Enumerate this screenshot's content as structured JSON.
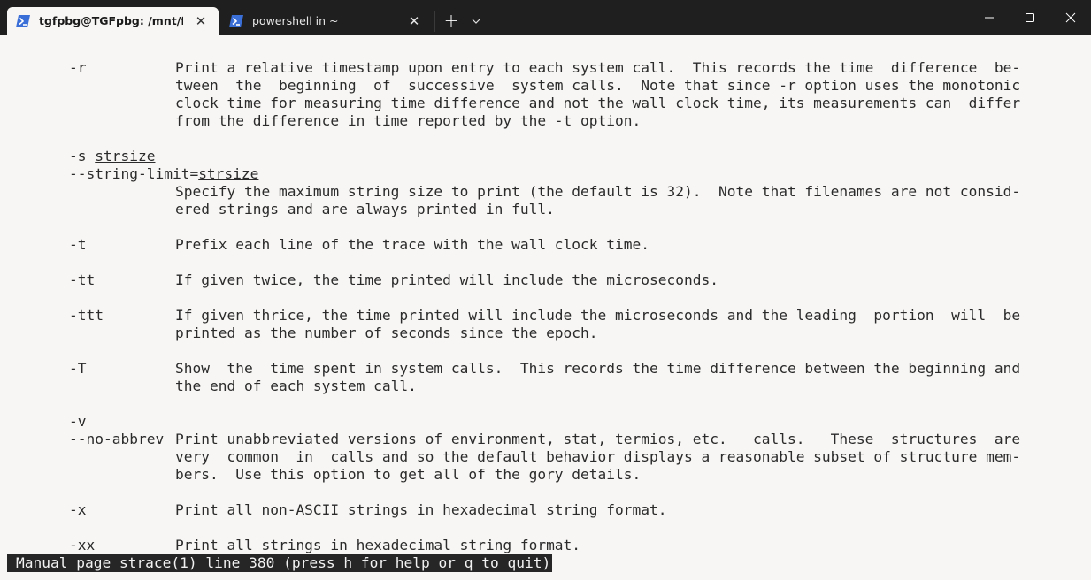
{
  "tabs": [
    {
      "title": "tgfpbg@TGFpbg: /mnt/f/Code",
      "icon": "powershell-icon",
      "close": "✕"
    },
    {
      "title": "powershell in ~",
      "icon": "powershell-icon",
      "close": "✕"
    }
  ],
  "new_tab": "+",
  "dropdown_icon": "chevron-down-icon",
  "window_controls": [
    "minimize-icon",
    "maximize-icon",
    "close-icon"
  ],
  "manpage": {
    "opt_r": "-r",
    "desc_r": [
      "Print a relative timestamp upon entry to each system call.  This records the time  difference  be‐",
      "tween  the  beginning  of  successive  system calls.  Note that since -r option uses the monotonic",
      "clock time for measuring time difference and not the wall clock time, its measurements can  differ",
      "from the difference in time reported by the -t option."
    ],
    "opt_s": "-s",
    "opt_s_arg": "strsize",
    "opt_string_limit": "--string-limit=",
    "opt_string_limit_arg": "strsize",
    "desc_s": [
      "Specify the maximum string size to print (the default is 32).  Note that filenames are not consid‐",
      "ered strings and are always printed in full."
    ],
    "opt_t": "-t",
    "desc_t": "Prefix each line of the trace with the wall clock time.",
    "opt_tt": "-tt",
    "desc_tt": "If given twice, the time printed will include the microseconds.",
    "opt_ttt": "-ttt",
    "desc_ttt": [
      "If given thrice, the time printed will include the microseconds and the leading  portion  will  be",
      "printed as the number of seconds since the epoch."
    ],
    "opt_T": "-T",
    "desc_T": [
      "Show  the  time spent in system calls.  This records the time difference between the beginning and",
      "the end of each system call."
    ],
    "opt_v": "-v",
    "opt_no_abbrev": "--no-abbrev",
    "desc_v": [
      "Print unabbreviated versions of environment, stat, termios, etc.   calls.   These  structures  are",
      "very  common  in  calls and so the default behavior displays a reasonable subset of structure mem‐",
      "bers.  Use this option to get all of the gory details."
    ],
    "opt_x": "-x",
    "desc_x": "Print all non-ASCII strings in hexadecimal string format.",
    "opt_xx": "-xx",
    "desc_xx": "Print all strings in hexadecimal string format."
  },
  "status_bar": "Manual page strace(1) line 380 (press h for help or q to quit)",
  "colors": {
    "titlebar_bg": "#1f1f1f",
    "terminal_bg": "#f7f6f4",
    "terminal_fg": "#2b2b2b",
    "status_bg": "#262626",
    "status_fg": "#f2f2f2",
    "powershell_icon": "#3a6fd8"
  }
}
